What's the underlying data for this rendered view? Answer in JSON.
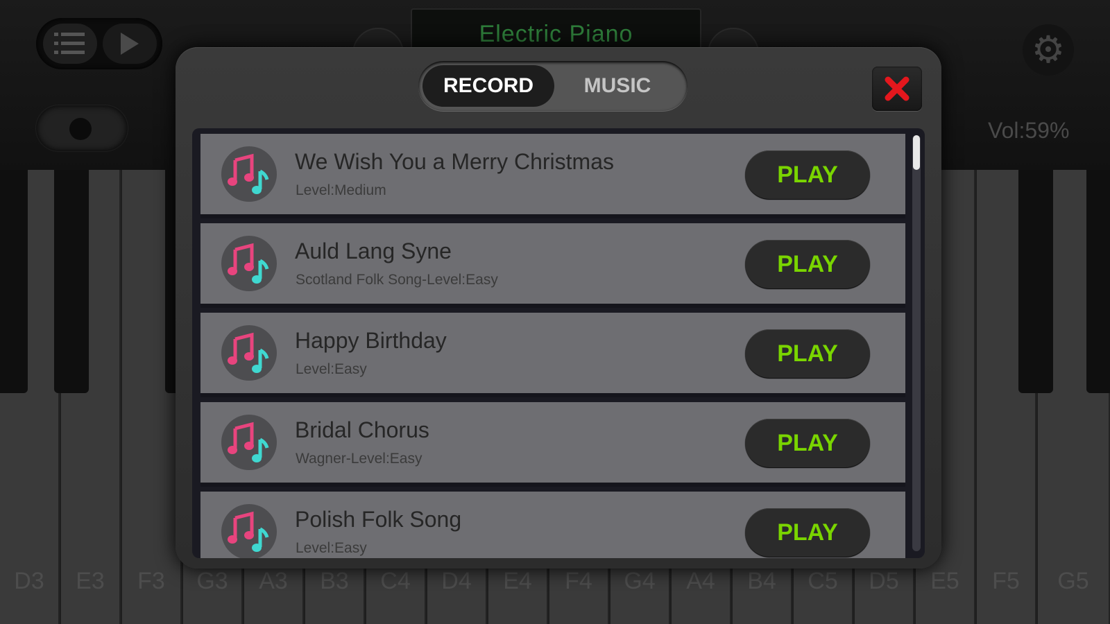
{
  "app": {
    "instrument": "Electric Piano",
    "volume": "Vol:59%"
  },
  "keys": [
    "D3",
    "E3",
    "F3",
    "G3",
    "A3",
    "B3",
    "C4",
    "D4",
    "E4",
    "F4",
    "G4",
    "A4",
    "B4",
    "C5",
    "D5",
    "E5",
    "F5",
    "G5"
  ],
  "dialog": {
    "tabs": [
      {
        "label": "RECORD",
        "active": true
      },
      {
        "label": "MUSIC",
        "active": false
      }
    ],
    "close_icon": "close-x-icon",
    "songs": [
      {
        "title": "We Wish You a Merry Christmas",
        "subtitle": "Level:Medium",
        "action": "PLAY"
      },
      {
        "title": "Auld Lang Syne",
        "subtitle": "Scotland Folk Song-Level:Easy",
        "action": "PLAY"
      },
      {
        "title": "Happy Birthday",
        "subtitle": "Level:Easy",
        "action": "PLAY"
      },
      {
        "title": "Bridal Chorus",
        "subtitle": "Wagner-Level:Easy",
        "action": "PLAY"
      },
      {
        "title": "Polish Folk Song",
        "subtitle": "Level:Easy",
        "action": "PLAY"
      }
    ]
  },
  "colors": {
    "play_text": "#7ad500",
    "close_red": "#e4171d",
    "note_pink": "#e8447e",
    "note_cyan": "#3fd8d0",
    "display_green": "#2e7d3a"
  }
}
